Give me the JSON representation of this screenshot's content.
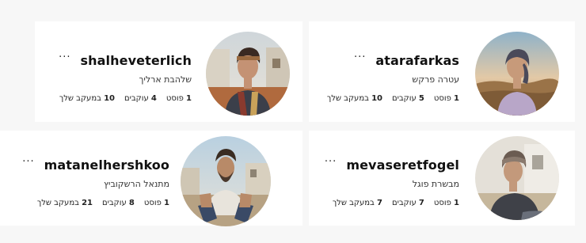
{
  "cards": [
    {
      "username": "atarafarkas",
      "fullname": "עטרה פרקש",
      "more": "···",
      "stats": [
        {
          "count": "1",
          "label": "פוסט"
        },
        {
          "count": "5",
          "label": "עוקבים"
        },
        {
          "count": "10",
          "label": "במעקב שלך"
        }
      ],
      "avatar_icon": "woman-headscarf-portrait"
    },
    {
      "username": "shalheveterlich",
      "fullname": "שלהבת ארליך",
      "more": "···",
      "stats": [
        {
          "count": "1",
          "label": "פוסט"
        },
        {
          "count": "4",
          "label": "עוקבים"
        },
        {
          "count": "10",
          "label": "במעקב שלך"
        }
      ],
      "avatar_icon": "woman-headband-portrait"
    },
    {
      "username": "mevaseretfogel",
      "fullname": "מבשרת פוגל",
      "more": "···",
      "stats": [
        {
          "count": "1",
          "label": "פוסט"
        },
        {
          "count": "7",
          "label": "עוקבים"
        },
        {
          "count": "7",
          "label": "במעקב שלך"
        }
      ],
      "avatar_icon": "woman-headscarf-sitting-portrait"
    },
    {
      "username": "matanelhershkoo",
      "fullname": "מתנאל הרשקוביץ",
      "more": "···",
      "stats": [
        {
          "count": "1",
          "label": "פוסט"
        },
        {
          "count": "8",
          "label": "עוקבים"
        },
        {
          "count": "21",
          "label": "במעקב שלך"
        }
      ],
      "avatar_icon": "bearded-man-sitting-portrait"
    }
  ]
}
